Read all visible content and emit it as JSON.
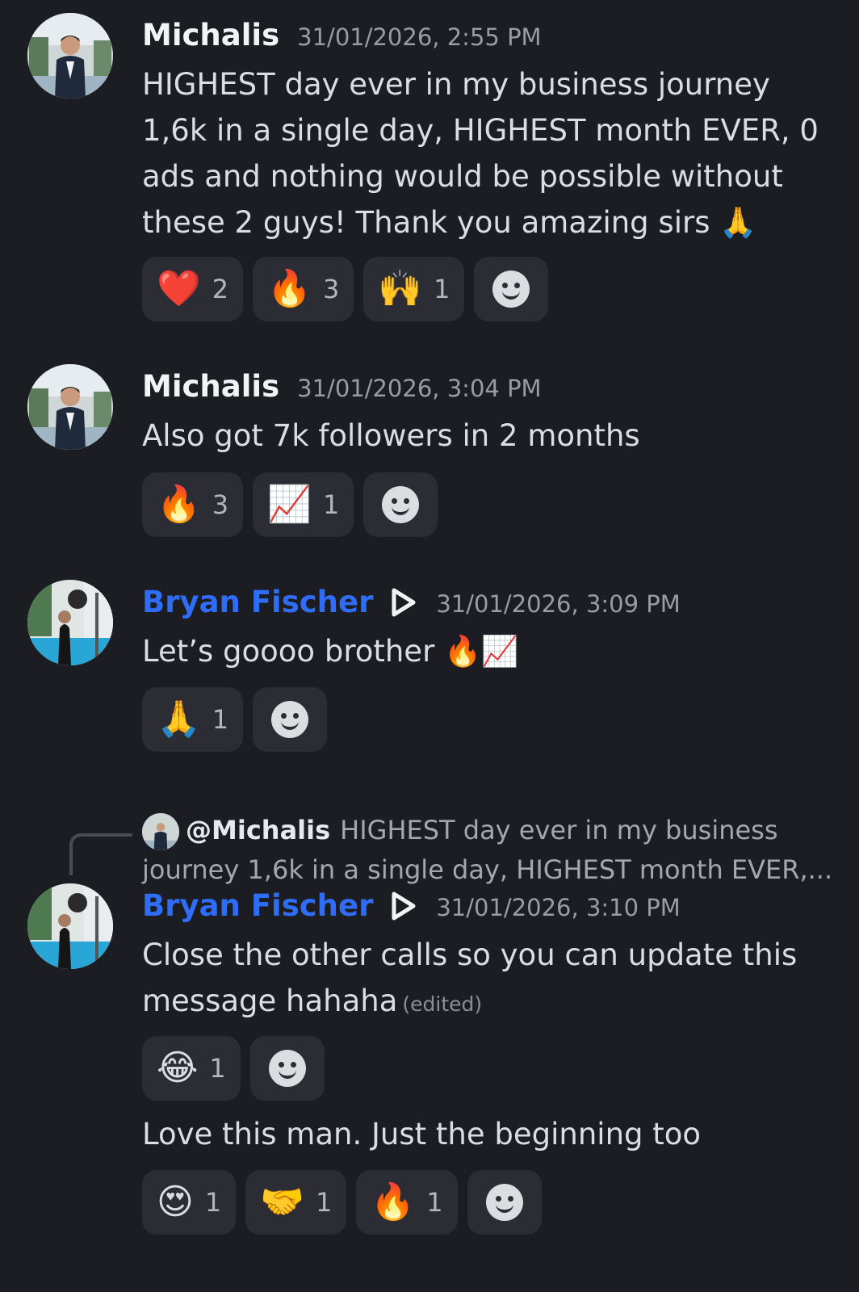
{
  "messages": [
    {
      "author": "Michalis",
      "timestamp": "31/01/2026, 2:55 PM",
      "text": "HIGHEST day ever in my business journey 1,6k in a single day, HIGHEST month EVER, 0 ads and nothing would be possible without these 2 guys! Thank you amazing sirs 🙏",
      "reactions": [
        {
          "emoji": "❤️",
          "count": "2"
        },
        {
          "emoji": "🔥",
          "count": "3"
        },
        {
          "emoji": "🙌",
          "count": "1"
        }
      ]
    },
    {
      "author": "Michalis",
      "timestamp": "31/01/2026, 3:04 PM",
      "text": "Also got 7k followers in 2 months",
      "reactions": [
        {
          "emoji": "🔥",
          "count": "3"
        },
        {
          "emoji": "📈",
          "count": "1"
        }
      ]
    },
    {
      "author": "Bryan Fischer",
      "timestamp": "31/01/2026, 3:09 PM",
      "text": "Let’s goooo brother 🔥📈",
      "reactions": [
        {
          "emoji": "🙏",
          "count": "1"
        }
      ]
    },
    {
      "reply_to": {
        "mention": "@Michalis",
        "snippet": "HIGHEST day ever in my business journey 1,6k in a single day, HIGHEST month EVER,..."
      },
      "author": "Bryan Fischer",
      "timestamp": "31/01/2026, 3:10 PM",
      "text": "Close the other calls so you can update this message hahaha",
      "edited_label": "(edited)",
      "reactions": [
        {
          "emoji": "😂",
          "count": "1"
        }
      ]
    },
    {
      "text": "Love this man. Just the beginning too",
      "reactions": [
        {
          "emoji": "😍",
          "count": "1"
        },
        {
          "emoji": "🤝",
          "count": "1"
        },
        {
          "emoji": "🔥",
          "count": "1"
        }
      ]
    }
  ],
  "icons": {
    "avatar_michalis": "avatar-michalis",
    "avatar_bryan": "avatar-bryan",
    "creator_badge": "play-badge-icon",
    "add_reaction": "add-reaction-smiley-icon"
  },
  "colors": {
    "background": "#1c1d23",
    "pill": "#2c2d34",
    "role_blue": "#2f6df6",
    "timestamp": "#9b9ca3"
  }
}
